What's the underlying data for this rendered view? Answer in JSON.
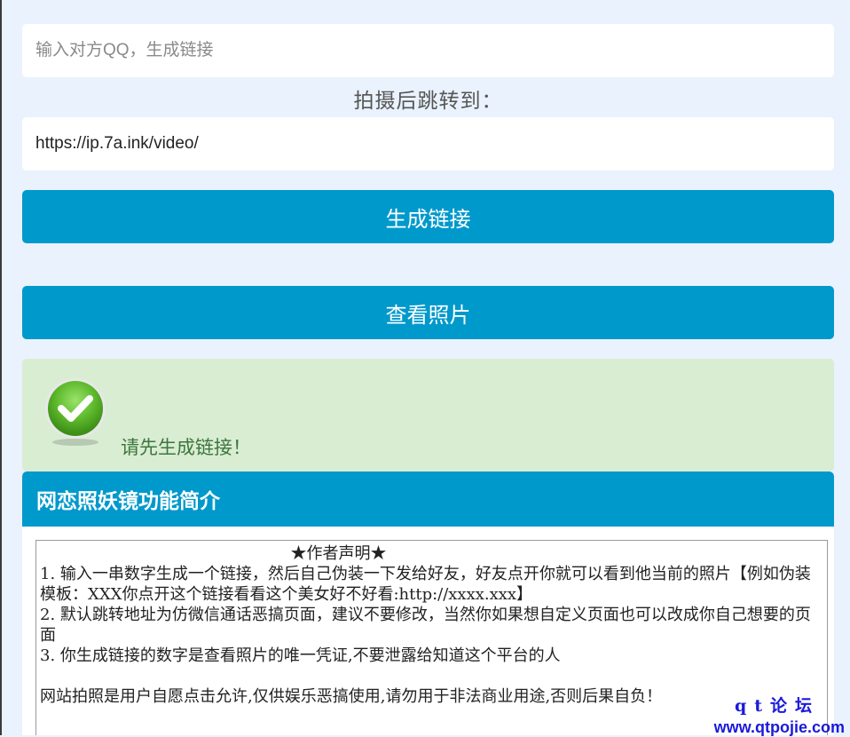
{
  "form": {
    "qq_placeholder": "输入对方QQ，生成链接",
    "redirect_label": "拍摄后跳转到：",
    "redirect_value": "https://ip.7a.ink/video/",
    "generate_label": "生成链接",
    "view_label": "查看照片"
  },
  "alert": {
    "message": "请先生成链接！",
    "icon": "check-circle-icon",
    "color": "#3c763d"
  },
  "panel": {
    "title": "网恋照妖镜功能简介",
    "notice_title": "★作者声明★",
    "lines": [
      "1. 输入一串数字生成一个链接，然后自己伪装一下发给好友，好友点开你就可以看到他当前的照片【例如伪装模板：XXX你点开这个链接看看这个美女好不好看:http://xxxx.xxx】",
      "2. 默认跳转地址为仿微信通话恶搞页面，建议不要修改，当然你如果想自定义页面也可以改成你自己想要的页面",
      "3. 你生成链接的数字是查看照片的唯一凭证,不要泄露给知道这个平台的人"
    ],
    "disclaimer": "网站拍照是用户自愿点击允许,仅供娱乐恶搞使用,请勿用于非法商业用途,否则后果自负！"
  },
  "watermark": {
    "line1": "qt论坛",
    "line2": "www.qtpojie.com"
  },
  "colors": {
    "background": "#eaf2fd",
    "accent": "#0099cc",
    "success_bg": "#d9edd3"
  }
}
